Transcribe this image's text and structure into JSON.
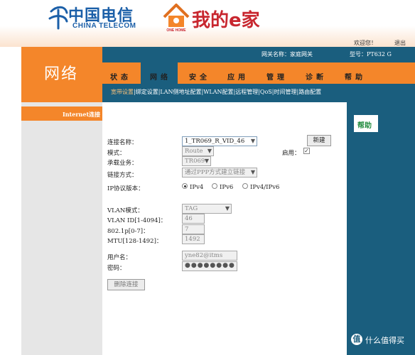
{
  "header": {
    "telecom_cn": "中国电信",
    "telecom_en": "CHINA TELECOM",
    "brand": "我的e家",
    "home_label": "ONE HOME",
    "welcome": "欢迎您！",
    "logout": "退出"
  },
  "info": {
    "gateway_name": "网关名称：家庭网关",
    "model": "型号：PT632 G"
  },
  "section_title": "网络",
  "nav": {
    "tabs": [
      "状态",
      "网络",
      "安全",
      "应用",
      "管理",
      "诊断",
      "帮助"
    ],
    "active": "网络"
  },
  "subnav": {
    "items": [
      "宽带设置",
      "绑定设置",
      "LAN侧地址配置",
      "WLAN配置",
      "远程管理",
      "QoS",
      "时间管理",
      "路由配置"
    ],
    "active": "宽带设置"
  },
  "sidebar": {
    "items": [
      {
        "label": "Internet连接"
      }
    ]
  },
  "form": {
    "connection_name_label": "连接名称：",
    "connection_name_value": "1_TR069_R_VID_46",
    "new_button": "新建",
    "mode_label": "模式：",
    "mode_value": "Route",
    "enable_label": "启用：",
    "enable_checked": true,
    "service_label": "承载业务：",
    "service_value": "TR069",
    "link_label": "链接方式：",
    "link_value": "通过PPP方式建立链接",
    "ip_label": "IP协议版本：",
    "ip_options": [
      "IPv4",
      "IPv6",
      "IPv4/IPv6"
    ],
    "ip_selected": "IPv4",
    "vlan_mode_label": "VLAN模式：",
    "vlan_mode_value": "TAG",
    "vlan_id_label": "VLAN ID[1-4094]：",
    "vlan_id_value": "46",
    "p8021_label": "802.1p[0-7]：",
    "p8021_value": "7",
    "mtu_label": "MTU[128-1492]：",
    "mtu_value": "1492",
    "username_label": "用户名：",
    "username_value": "yne82@itms",
    "password_label": "密码：",
    "password_value": "●●●●●●●●",
    "delete_button": "删除连接"
  },
  "help": {
    "label": "帮助"
  },
  "watermark": {
    "text": "什么值得买",
    "icon": "值"
  },
  "colors": {
    "orange": "#f4862a",
    "teal": "#1a5e7e",
    "telecom_blue": "#1b5fa8",
    "brand_red": "#c8272f"
  }
}
